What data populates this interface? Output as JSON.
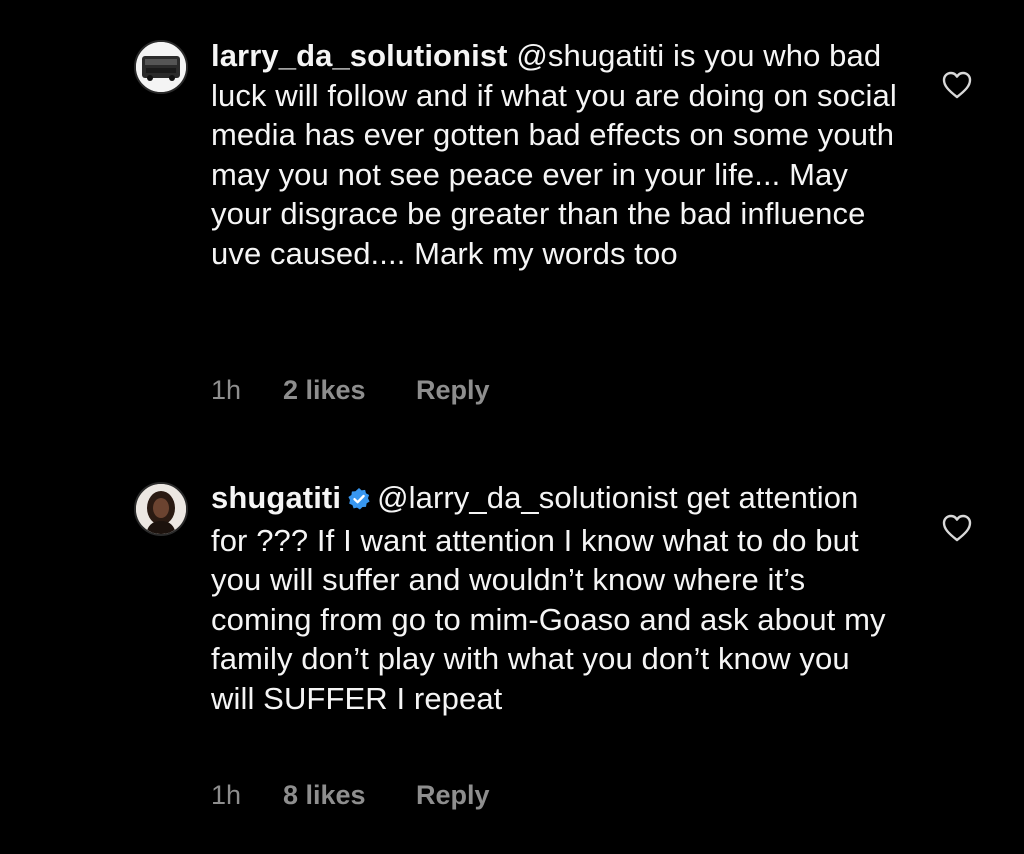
{
  "comments": [
    {
      "username": "larry_da_solutionist",
      "verified": false,
      "mention": "@shugatiti",
      "text": " is you who bad luck will follow and if what you are doing on social media has ever gotten bad effects on some youth may you not see peace ever in your life... May your disgrace be greater than the bad influence uve caused.... Mark my words too",
      "time": "1h",
      "likes": "2 likes",
      "reply_label": "Reply",
      "avatar_icon": "car-photo-avatar"
    },
    {
      "username": "shugatiti",
      "verified": true,
      "verified_color": "#3897f0",
      "mention": "@larry_da_solutionist",
      "text": " get attention for ??? If I want attention I know what to do but you will suffer and wouldn’t know where it’s coming from go to mim-Goaso and ask about my family don’t play with what you don’t know you will SUFFER I repeat",
      "time": "1h",
      "likes": "8 likes",
      "reply_label": "Reply",
      "avatar_icon": "woman-portrait-avatar"
    }
  ],
  "colors": {
    "background": "#000000",
    "text": "#f5f5f5",
    "secondary": "#8e8e8e"
  }
}
